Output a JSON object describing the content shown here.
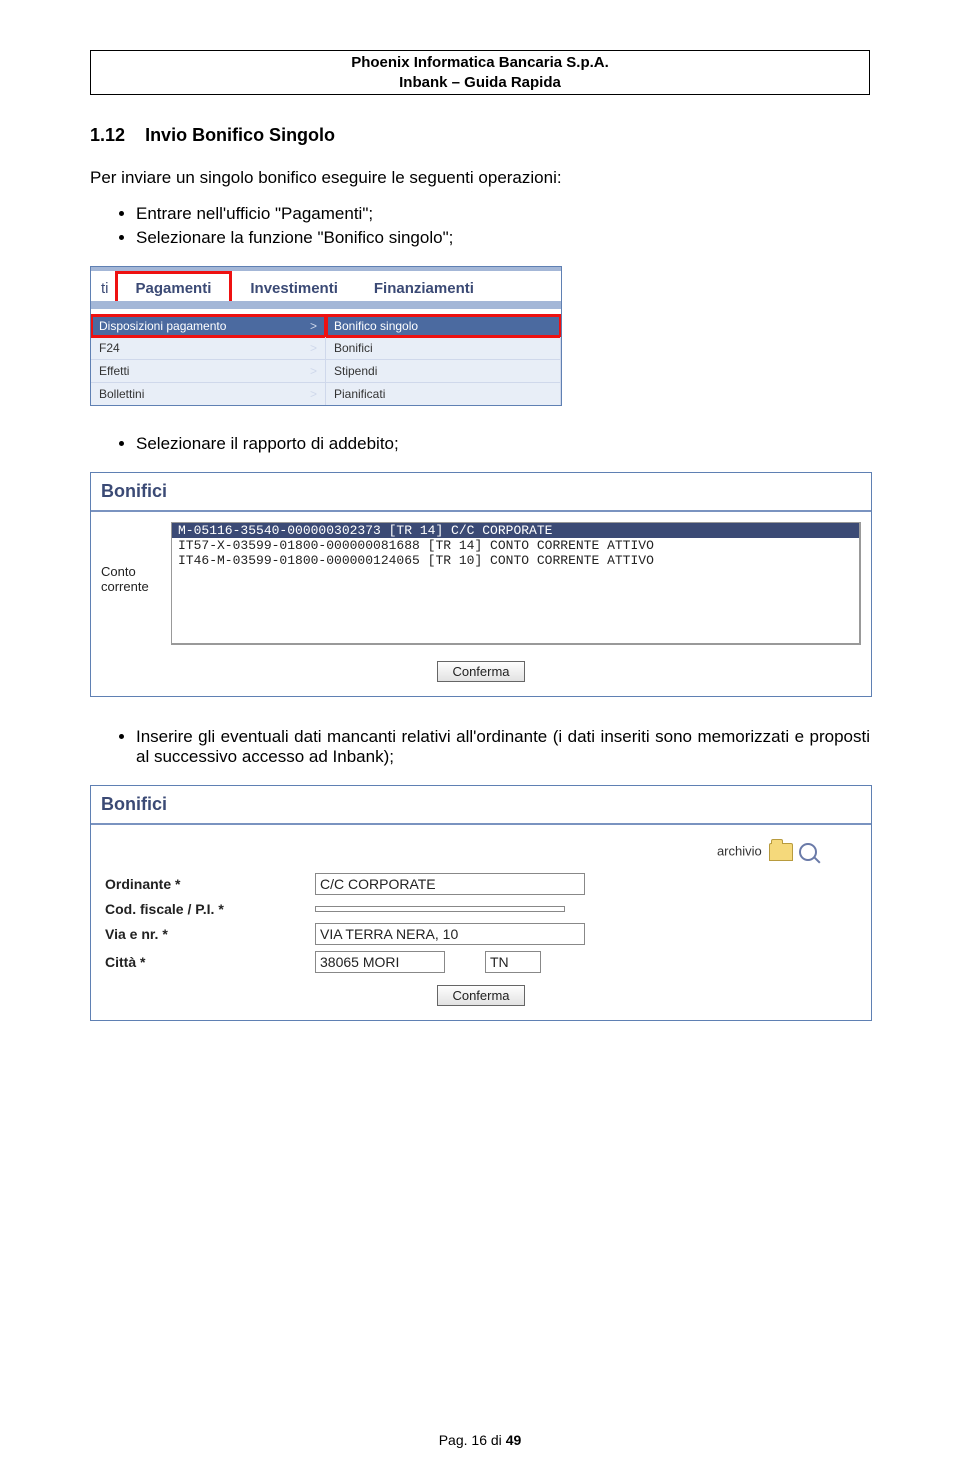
{
  "header": {
    "line1": "Phoenix Informatica Bancaria S.p.A.",
    "line2": "Inbank – Guida Rapida"
  },
  "section_num": "1.12",
  "section_title": "Invio Bonifico Singolo",
  "intro": "Per inviare un singolo bonifico eseguire le seguenti operazioni:",
  "bullets1": {
    "a": "Entrare nell'ufficio \"Pagamenti\";",
    "b": "Selezionare la funzione \"Bonifico singolo\";"
  },
  "tabs": {
    "ti": "ti",
    "pagamenti": "Pagamenti",
    "investimenti": "Investimenti",
    "finanziamenti": "Finanziamenti"
  },
  "menu": {
    "dispo": "Disposizioni pagamento",
    "bonifico_singolo": "Bonifico singolo",
    "f24": "F24",
    "bonifici": "Bonifici",
    "effetti": "Effetti",
    "stipendi": "Stipendi",
    "bollettini": "Bollettini",
    "pianificati": "Pianificati",
    "caret": ">"
  },
  "bullet2": "Selezionare il rapporto di addebito;",
  "panel2": {
    "title": "Bonifici",
    "label": "Conto corrente",
    "rows": {
      "r0": "M-05116-35540-000000302373 [TR 14] C/C CORPORATE",
      "r1": "IT57-X-03599-01800-000000081688 [TR 14] CONTO CORRENTE ATTIVO",
      "r2": "IT46-M-03599-01800-000000124065 [TR 10] CONTO CORRENTE ATTIVO"
    },
    "btn": "Conferma"
  },
  "bullet3": "Inserire gli eventuali dati mancanti relativi all'ordinante (i dati inseriti sono memorizzati e proposti al successivo accesso ad Inbank);",
  "panel3": {
    "title": "Bonifici",
    "archivio": "archivio",
    "labels": {
      "ordinante": "Ordinante *",
      "cf": "Cod. fiscale / P.I. *",
      "via": "Via e nr. *",
      "citta": "Città *"
    },
    "values": {
      "ordinante": "C/C CORPORATE",
      "cf": "",
      "via": "VIA TERRA NERA, 10",
      "citta_cap": "38065 MORI",
      "citta_prov": "TN"
    },
    "btn": "Conferma"
  },
  "footer": {
    "pag": "Pag. ",
    "n": "16",
    "di": " di ",
    "tot": "49"
  }
}
